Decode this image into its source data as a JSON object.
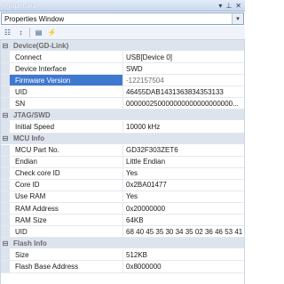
{
  "window": {
    "title": "Properties",
    "controls": {
      "dropdown": "▾",
      "pin": "⊥",
      "close": "✕"
    }
  },
  "object_selector": {
    "value": "Properties Window",
    "arrow": "▾"
  },
  "toolbar": {
    "icons": [
      "categorized-icon",
      "alphabetical-icon",
      "property-pages-icon",
      "events-icon"
    ],
    "glyphs": {
      "categorized": "☷",
      "alphabetical": "↕",
      "pages": "▤",
      "events": "⚡"
    }
  },
  "categories": [
    {
      "name": "Device(GD-Link)",
      "toggle": "⊟",
      "rows": [
        {
          "name": "Connect",
          "value": "USB[Device 0]"
        },
        {
          "name": "Device Interface",
          "value": "SWD"
        },
        {
          "name": "Firmware Version",
          "value": "-122157504",
          "selected": true
        },
        {
          "name": "UID",
          "value": "46455DAB1431363834353133"
        },
        {
          "name": "SN",
          "value": "000000250000000000000000000..."
        }
      ]
    },
    {
      "name": "JTAG/SWD",
      "toggle": "⊟",
      "rows": [
        {
          "name": "Initial Speed",
          "value": "10000 kHz"
        }
      ]
    },
    {
      "name": "MCU Info",
      "toggle": "⊟",
      "rows": [
        {
          "name": "MCU Part No.",
          "value": "GD32F303ZET6"
        },
        {
          "name": "Endian",
          "value": "Little Endian"
        },
        {
          "name": "Check core ID",
          "value": "Yes"
        },
        {
          "name": "Core ID",
          "value": "0x2BA01477"
        },
        {
          "name": "Use RAM",
          "value": "Yes"
        },
        {
          "name": "RAM Address",
          "value": "0x20000000"
        },
        {
          "name": "RAM Size",
          "value": "64KB"
        },
        {
          "name": "UID",
          "value": "68 40 45 35 30 34 35 02 36 46 53 41"
        }
      ]
    },
    {
      "name": "Flash Info",
      "toggle": "⊟",
      "rows": [
        {
          "name": "Size",
          "value": "512KB"
        },
        {
          "name": "Flash Base Address",
          "value": "0x8000000"
        }
      ]
    }
  ]
}
